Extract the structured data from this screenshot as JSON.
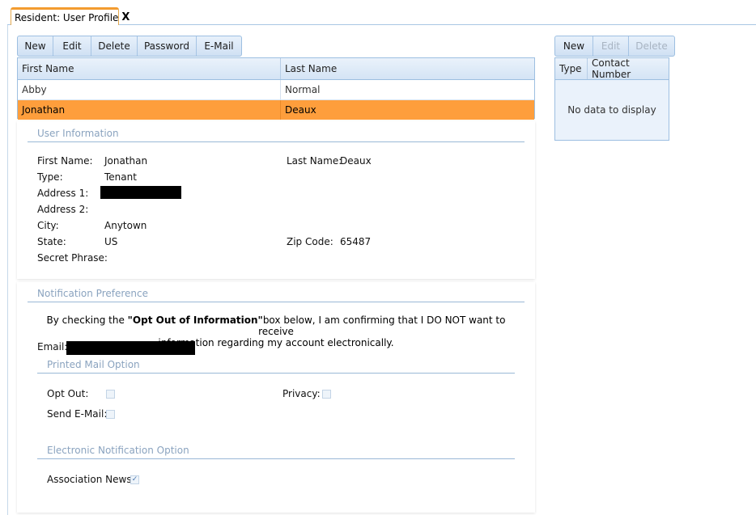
{
  "tab": {
    "title": "Resident: User Profile",
    "close": "X"
  },
  "users_toolbar": [
    {
      "label": "New",
      "enabled": true
    },
    {
      "label": "Edit",
      "enabled": true
    },
    {
      "label": "Delete",
      "enabled": true
    },
    {
      "label": "Password",
      "enabled": true
    },
    {
      "label": "E-Mail",
      "enabled": true
    }
  ],
  "users_grid": {
    "columns": [
      "First Name",
      "Last Name"
    ],
    "rows": [
      {
        "first": "Abby",
        "last": "Normal",
        "selected": false
      },
      {
        "first": "Jonathan",
        "last": "Deaux",
        "selected": true
      }
    ]
  },
  "contacts_toolbar": [
    {
      "label": "New",
      "enabled": true
    },
    {
      "label": "Edit",
      "enabled": false
    },
    {
      "label": "Delete",
      "enabled": false
    }
  ],
  "contacts_grid": {
    "columns": [
      "Type",
      "Contact Number"
    ],
    "empty_text": "No data to display"
  },
  "user_info": {
    "title": "User Information",
    "first_name_label": "First Name:",
    "first_name": "Jonathan",
    "last_name_label": "Last Name:",
    "last_name": "Deaux",
    "type_label": "Type:",
    "type": "Tenant",
    "address1_label": "Address 1:",
    "address2_label": "Address 2:",
    "city_label": "City:",
    "city": "Anytown",
    "state_label": "State:",
    "state": "US",
    "zip_label": "Zip Code:",
    "zip": "65487",
    "secret_label": "Secret Phrase:"
  },
  "notification": {
    "title": "Notification Preference",
    "notice_pre": "By checking the ",
    "notice_bold": "\"Opt Out of Information\"",
    "notice_post": "box below, I am confirming that I DO NOT want to receive",
    "notice_line2": "information regarding my account electronically.",
    "email_label": "Email:",
    "printed_title": "Printed Mail Option",
    "opt_out_label": "Opt Out:",
    "opt_out_checked": false,
    "privacy_label": "Privacy:",
    "privacy_checked": false,
    "send_email_label": "Send E-Mail:",
    "send_email_checked": false,
    "electronic_title": "Electronic Notification Option",
    "association_label": "Association News:",
    "association_checked": true
  },
  "colors": {
    "selected_row": "#fe9e3c",
    "tab_accent": "#f39b2f",
    "section_title": "#8aa3bf"
  }
}
